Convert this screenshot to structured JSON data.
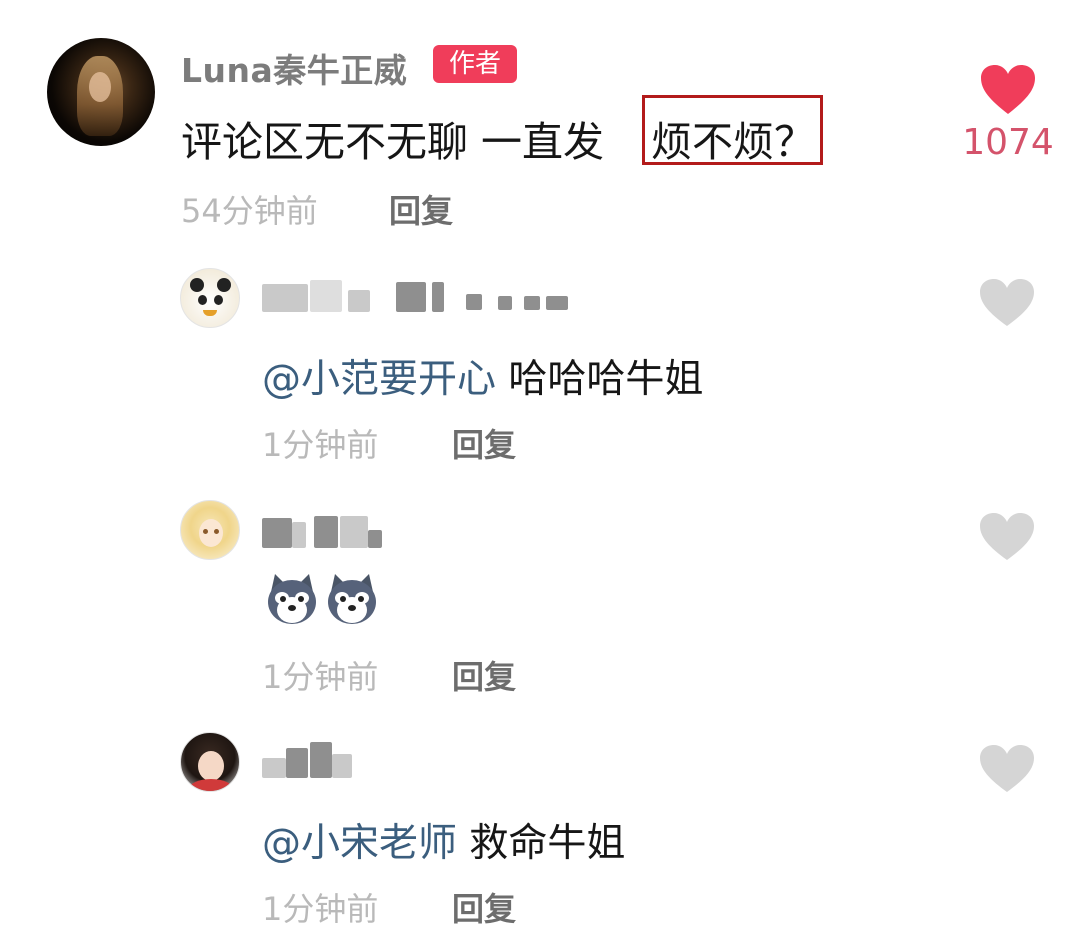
{
  "main_comment": {
    "username": "Luna秦牛正威",
    "badge": "作者",
    "text_before": "评论区无不无聊 一直发",
    "text_highlighted": "烦不烦？",
    "time": "54分钟前",
    "reply_label": "回复",
    "like_count": "1074",
    "like_color": "#f03d5a"
  },
  "replies": [
    {
      "mention": "@小范要开心",
      "text": "哈哈哈牛姐",
      "time": "1分钟前",
      "reply_label": "回复"
    },
    {
      "emojis": [
        "doge-emoji",
        "doge-emoji"
      ],
      "time": "1分钟前",
      "reply_label": "回复"
    },
    {
      "mention": "@小宋老师",
      "text": "救命牛姐",
      "time": "1分钟前",
      "reply_label": "回复"
    }
  ],
  "colors": {
    "highlight_border": "#b31b1b",
    "mention": "#3b5e7e",
    "inactive_heart": "#d5d5d5"
  }
}
